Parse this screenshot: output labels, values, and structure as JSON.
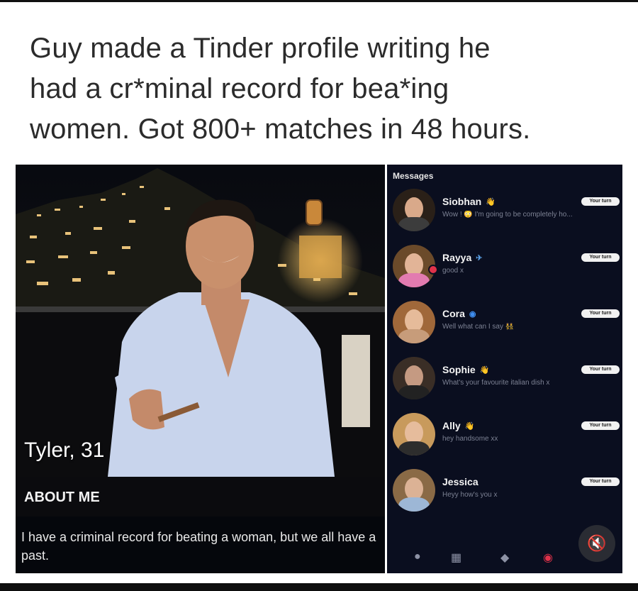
{
  "post": {
    "caption_lines": [
      "Guy made a Tinder profile writing he",
      "had a cr*minal record for bea*ing",
      "women. Got 800+ matches in 48 hours."
    ]
  },
  "profile": {
    "name_age": "Tyler, 31",
    "about_label": "ABOUT ME",
    "bio": "I have a criminal record for beating a woman, but we all have a past."
  },
  "messages": {
    "title": "Messages",
    "conversations": [
      {
        "name": "Siobhan",
        "preview": "Wow ! 😳 I'm going to be completely ho...",
        "badge": "Your turn",
        "verified": "👋",
        "avatar_hair": "#2a2018",
        "avatar_skin": "#d9a98a",
        "avatar_top": "#3c3c3c"
      },
      {
        "name": "Rayya",
        "preview": "good x",
        "badge": "Your turn",
        "verified": "✈",
        "avatar_hair": "#6b4a2a",
        "avatar_skin": "#e2b497",
        "avatar_top": "#e27bb0",
        "online": true
      },
      {
        "name": "Cora",
        "preview": "Well what can I say 👯‍♀️",
        "badge": "Your turn",
        "verified": "◉",
        "avatar_hair": "#a0683a",
        "avatar_skin": "#e6bb9a",
        "avatar_top": "#c79c7a"
      },
      {
        "name": "Sophie",
        "preview": "What's your favourite italian dish x",
        "badge": "Your turn",
        "verified": "👋",
        "avatar_hair": "#3a2e26",
        "avatar_skin": "#c59a82",
        "avatar_top": "#222222"
      },
      {
        "name": "Ally",
        "preview": "hey handsome xx",
        "badge": "Your turn",
        "verified": "👋",
        "avatar_hair": "#c89a5c",
        "avatar_skin": "#e6bc9c",
        "avatar_top": "#2d2d2d"
      },
      {
        "name": "Jessica",
        "preview": "Heyy how's you x",
        "badge": "Your turn",
        "verified": "",
        "avatar_hair": "#8a6a46",
        "avatar_skin": "#dcb295",
        "avatar_top": "#9db7d6"
      }
    ]
  },
  "tabbar": {
    "icons": [
      "flame-icon",
      "explore-grid-icon",
      "likes-icon",
      "chat-icon"
    ],
    "mute_icon": "speaker-muted-icon",
    "mute_glyph": "🔇"
  },
  "colors": {
    "messages_bg": "#0a0e1f",
    "badge_bg": "#f1f1f1",
    "accent_red": "#e0324a"
  }
}
